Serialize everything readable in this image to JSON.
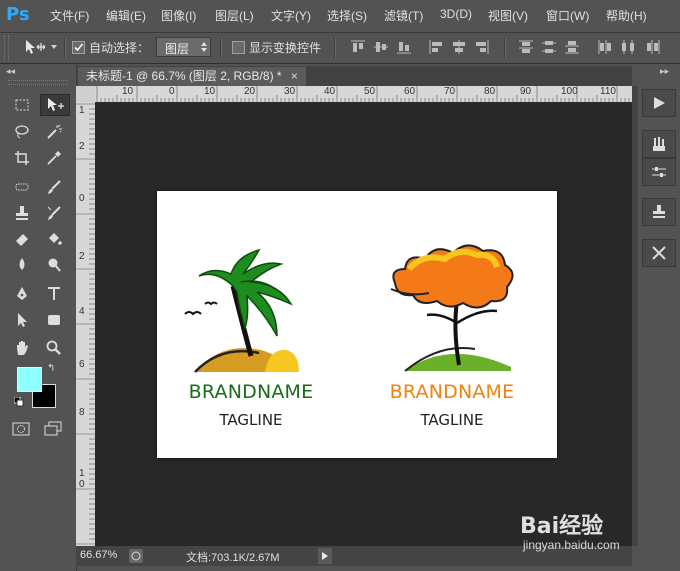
{
  "app": {
    "logo": "Ps"
  },
  "menu": [
    "文件(F)",
    "编辑(E)",
    "图像(I)",
    "图层(L)",
    "文字(Y)",
    "选择(S)",
    "滤镜(T)",
    "3D(D)",
    "视图(V)",
    "窗口(W)",
    "帮助(H)"
  ],
  "options": {
    "auto_select_label": "自动选择：",
    "auto_select_target": "图层",
    "show_transform_label": "显示变换控件"
  },
  "document": {
    "tab_title": "未标题-1 @ 66.7% (图层 2, RGB/8) *",
    "close_glyph": "×"
  },
  "rulers": {
    "top": [
      "10",
      "0",
      "10",
      "20",
      "30",
      "40",
      "50",
      "60",
      "70",
      "80",
      "90",
      "100",
      "110"
    ],
    "left": [
      "1",
      "2",
      "0",
      "2",
      "4",
      "6",
      "8",
      "1 0"
    ]
  },
  "status": {
    "zoom": "66.67%",
    "doc_info": "文档:703.1K/2.67M"
  },
  "logos": [
    {
      "brand": "BRANDNAME",
      "tagline": "TAGLINE",
      "brand_color": "#1a6b1a",
      "icon": "palm-tree-icon"
    },
    {
      "brand": "BRANDNAME",
      "tagline": "TAGLINE",
      "brand_color": "#f0820f",
      "icon": "orange-tree-icon"
    }
  ],
  "colors": {
    "foreground": "#8fffff",
    "background": "#000000"
  },
  "watermark": {
    "brand": "Bai经验",
    "url": "jingyan.baidu.com"
  }
}
